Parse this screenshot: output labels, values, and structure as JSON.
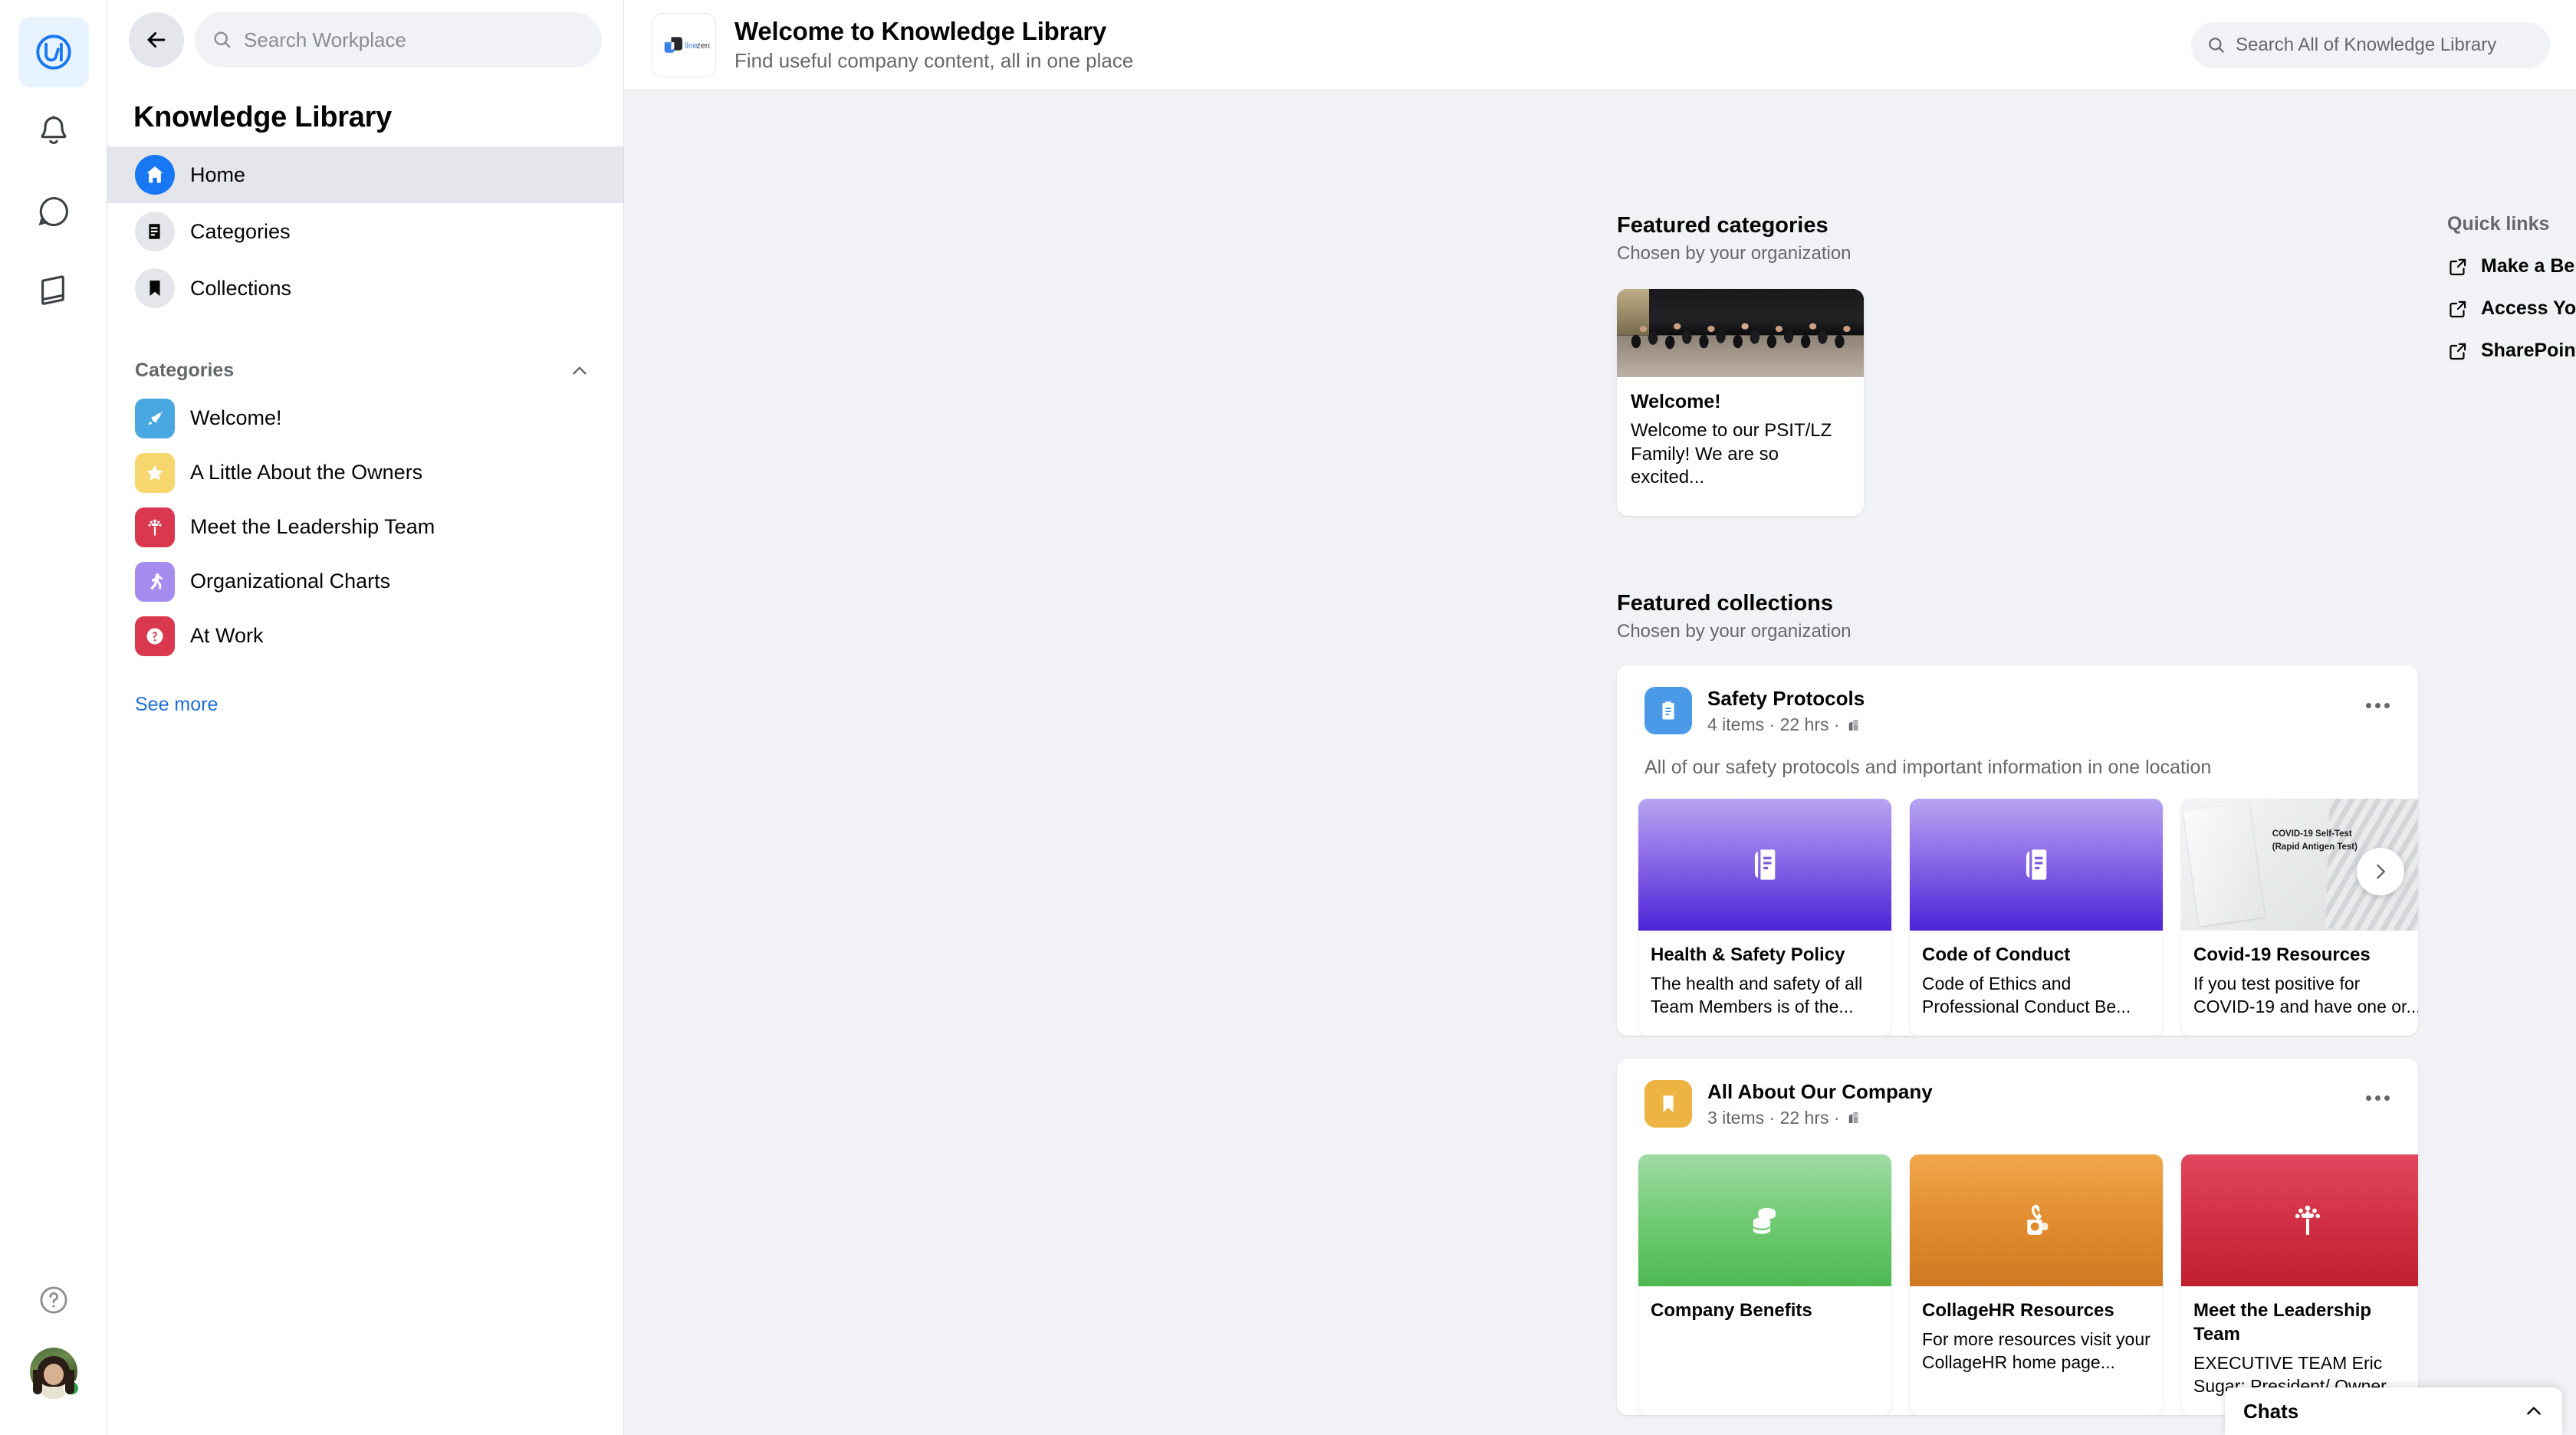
{
  "rail": {
    "items": [
      {
        "name": "workplace-home",
        "icon": "workplace-logo-icon",
        "active": true
      },
      {
        "name": "notifications",
        "icon": "bell-icon",
        "active": false
      },
      {
        "name": "chat",
        "icon": "chat-bubble-icon",
        "active": false
      },
      {
        "name": "knowledge-library",
        "icon": "book-icon",
        "active": false
      }
    ],
    "help_icon": "help-circle-icon",
    "avatar_status": "online"
  },
  "sidebar": {
    "back_icon": "back-arrow-icon",
    "search_placeholder": "Search Workplace",
    "search_value": "",
    "title": "Knowledge Library",
    "nav": [
      {
        "label": "Home",
        "icon": "home-icon",
        "selected": true
      },
      {
        "label": "Categories",
        "icon": "categories-icon",
        "selected": false
      },
      {
        "label": "Collections",
        "icon": "bookmark-icon",
        "selected": false
      }
    ],
    "categories_header": "Categories",
    "categories_collapse_icon": "chevron-up-icon",
    "categories": [
      {
        "label": "Welcome!",
        "icon": "rocket-icon",
        "color": "#4aa8e0"
      },
      {
        "label": "A Little About the Owners",
        "icon": "star-icon",
        "color": "#f5d76e"
      },
      {
        "label": "Meet the Leadership Team",
        "icon": "tree-icon",
        "color": "#d9384f"
      },
      {
        "label": "Organizational Charts",
        "icon": "running-person-icon",
        "color": "#a58cee"
      },
      {
        "label": "At Work",
        "icon": "question-mark-icon",
        "color": "#d9384f"
      }
    ],
    "see_more": "See more"
  },
  "topbar": {
    "logo": "linezero-logo",
    "logo_text_line": "line",
    "logo_text_zero": "zero",
    "title": "Welcome to Knowledge Library",
    "subtitle": "Find useful company content, all in one place",
    "search_placeholder": "Search All of Knowledge Library",
    "search_value": "",
    "search_icon": "search-icon"
  },
  "featured_categories": {
    "title": "Featured categories",
    "subtitle": "Chosen by your organization",
    "cards": [
      {
        "title": "Welcome!",
        "description": "Welcome to our PSIT/LZ Family! We are so excited...",
        "image": "team-group-photo"
      }
    ]
  },
  "quick_links": {
    "title": "Quick links",
    "links": [
      {
        "label": "Make a Benefits Claim",
        "icon": "external-link-icon"
      },
      {
        "label": "Access Your Pay Stub",
        "icon": "external-link-icon"
      },
      {
        "label": "SharePoint",
        "icon": "external-link-icon"
      }
    ]
  },
  "featured_collections": {
    "title": "Featured collections",
    "subtitle": "Chosen by your organization",
    "collections": [
      {
        "title": "Safety Protocols",
        "icon": "clipboard-icon",
        "icon_color": "#4a9ae8",
        "meta": "4 items · 22 hrs ·",
        "audience_icon": "company-building-icon",
        "menu_icon": "more-options-icon",
        "description": "All of our safety protocols and important information in one location",
        "next_icon": "chevron-right-icon",
        "items": [
          {
            "title": "Health & Safety Policy",
            "description": "The health and safety of all Team Members is of the...",
            "thumb": "purple",
            "thumb_icon": "document-icon"
          },
          {
            "title": "Code of Conduct",
            "description": "Code of Ethics and Professional Conduct Be...",
            "thumb": "purple",
            "thumb_icon": "document-icon"
          },
          {
            "title": "Covid-19 Resources",
            "description": "If you test positive for COVID-19 and have one or...",
            "thumb": "covid",
            "thumb_caption_line1": "COVID-19 Self-Test",
            "thumb_caption_line2": "(Rapid Antigen Test)"
          }
        ]
      },
      {
        "title": "All About Our Company",
        "icon": "bookmark-icon",
        "icon_color": "#edb343",
        "meta": "3 items · 22 hrs ·",
        "audience_icon": "company-building-icon",
        "menu_icon": "more-options-icon",
        "description": "",
        "items": [
          {
            "title": "Company Benefits",
            "description": "",
            "thumb": "green",
            "thumb_icon": "coins-icon"
          },
          {
            "title": "CollageHR Resources",
            "description": "For more resources visit your CollageHR home page...",
            "thumb": "orange",
            "thumb_icon": "handshake-icon"
          },
          {
            "title": "Meet the Leadership Team",
            "description": "EXECUTIVE TEAM Eric Sugar: President/ Owner...",
            "thumb": "red",
            "thumb_icon": "tree-icon"
          }
        ]
      }
    ]
  },
  "chats": {
    "label": "Chats",
    "collapse_icon": "chevron-up-icon"
  },
  "colors": {
    "accent_blue": "#1877f2",
    "page_bg": "#f0f2f5",
    "card_bg": "#ffffff",
    "text_primary": "#050505",
    "text_secondary": "#65676b",
    "link": "#216fdb",
    "online_green": "#31a24c"
  }
}
